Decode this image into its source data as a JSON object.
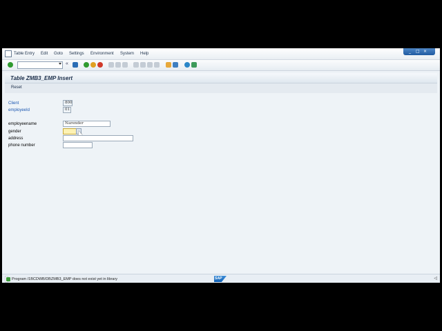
{
  "menubar": {
    "items": [
      "Table Entry",
      "Edit",
      "Goto",
      "Settings",
      "Environment",
      "System",
      "Help"
    ],
    "window_controls": [
      "_",
      "□",
      "×"
    ]
  },
  "toolbar": {
    "back_glyph": "«",
    "icons": [
      "enter-icon",
      "save-icon",
      "back-icon",
      "exit-icon",
      "cancel-icon",
      "print-icon",
      "find-icon",
      "find-next-icon",
      "first-page-icon",
      "previous-page-icon",
      "next-page-icon",
      "last-page-icon",
      "create-session-icon",
      "generate-shortcut-icon",
      "help-icon",
      "customize-layout-icon"
    ],
    "colors": {
      "enter": "#2f9a2f",
      "save": "#2a6db5",
      "back": "#e0a020",
      "exit": "#d28a20",
      "cancel": "#d03a2a"
    }
  },
  "title": "Table ZMB3_EMP Insert",
  "appbar": {
    "reset_label": "Reset"
  },
  "form": {
    "client_label": "Client",
    "client_value": "800",
    "employeeid_label": "employeeId",
    "employeeid_value": "01",
    "employeename_label": "employeename",
    "employeename_value": "Narender",
    "gender_label": "gender",
    "gender_value": "",
    "address_label": "address",
    "address_value": "",
    "phone_label": "phone number",
    "phone_value": ""
  },
  "status": {
    "message": "Program /1BCDWB/DBZMB3_EMP does not exist yet in library",
    "logo": "SAP",
    "right_glyph": "◁"
  }
}
